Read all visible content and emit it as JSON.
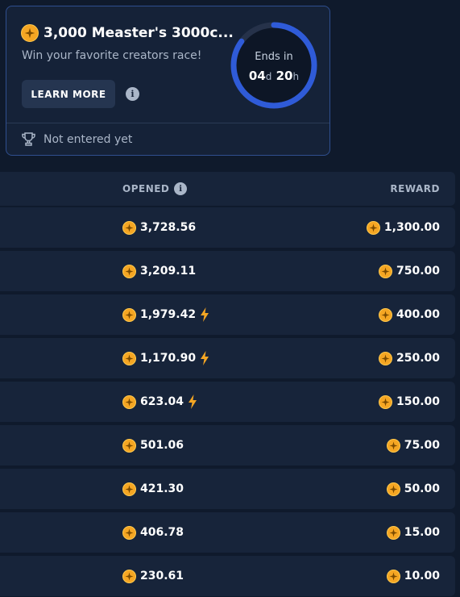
{
  "race": {
    "title": "3,000 Measter's 3000c...",
    "subtitle": "Win your favorite creators race!",
    "learn_more": "LEARN MORE",
    "timer": {
      "label": "Ends in",
      "days": "04",
      "days_unit": "d",
      "hours": "20",
      "hours_unit": "h",
      "progress": 0.85
    },
    "status": "Not entered yet"
  },
  "leaderboard": {
    "columns": {
      "opened": "OPENED",
      "reward": "REWARD"
    },
    "rows": [
      {
        "opened": "3,728.56",
        "reward": "1,300.00",
        "boosted": false
      },
      {
        "opened": "3,209.11",
        "reward": "750.00",
        "boosted": false
      },
      {
        "opened": "1,979.42",
        "reward": "400.00",
        "boosted": true
      },
      {
        "opened": "1,170.90",
        "reward": "250.00",
        "boosted": true
      },
      {
        "opened": "623.04",
        "reward": "150.00",
        "boosted": true
      },
      {
        "opened": "501.06",
        "reward": "75.00",
        "boosted": false
      },
      {
        "opened": "421.30",
        "reward": "50.00",
        "boosted": false
      },
      {
        "opened": "406.78",
        "reward": "15.00",
        "boosted": false
      },
      {
        "opened": "230.61",
        "reward": "10.00",
        "boosted": false
      }
    ]
  },
  "colors": {
    "accent": "#2f5bd8",
    "coin": "#f5a623",
    "bolt": "#f5a623",
    "card_border": "#2f4f8f",
    "background": "#0f1a2c"
  },
  "icons": {
    "coin": "coin-icon",
    "info": "info-icon",
    "trophy": "trophy-icon",
    "bolt": "lightning-bolt-icon"
  }
}
